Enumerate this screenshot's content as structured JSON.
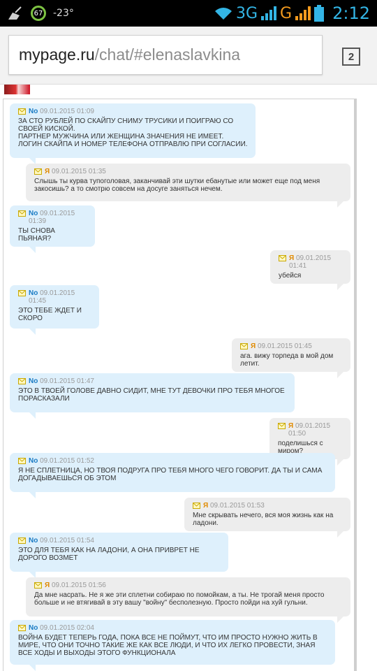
{
  "status_bar": {
    "battery_percent": "67",
    "temperature": "-23°",
    "network_3g": "3G",
    "network_g": "G",
    "time": "2:12"
  },
  "browser": {
    "url_host": "mypage.ru",
    "url_path": "/chat/#elenaslavkina",
    "tab_count": "2"
  },
  "chat": {
    "messages": [
      {
        "sender": "No",
        "time": "09.01.2015 01:09",
        "text": "ЗА СТО РУБЛЕЙ ПО СКАЙПУ СНИМУ ТРУСИКИ И ПОИГРАЮ СО СВОЕЙ КИСКОЙ.\nПАРТНЕР МУЖЧИНА ИЛИ ЖЕНЩИНА ЗНАЧЕНИЯ НЕ ИМЕЕТ.\nЛОГИН СКАЙПА И НОМЕР ТЕЛЕФОНА ОТПРАВЛЮ ПРИ СОГЛАСИИ."
      },
      {
        "sender": "Я",
        "time": "09.01.2015 01:35",
        "text": "Слышь ты курва тупоголовая, заканчивай эти шутки ебанутые или может еще под меня закосишь? а то смотрю совсем на досуге заняться нечем."
      },
      {
        "sender": "No",
        "time": "09.01.2015 01:39",
        "text": "ТЫ СНОВА ПЬЯНАЯ?"
      },
      {
        "sender": "Я",
        "time": "09.01.2015 01:41",
        "text": "убейся"
      },
      {
        "sender": "No",
        "time": "09.01.2015 01:45",
        "text": "ЭТО ТЕБЕ ЖДЕТ И СКОРО"
      },
      {
        "sender": "Я",
        "time": "09.01.2015 01:45",
        "text": "ага. вижу торпеда в мой дом летит."
      },
      {
        "sender": "No",
        "time": "09.01.2015 01:47",
        "text": "ЭТО В ТВОЕЙ ГОЛОВЕ ДАВНО СИДИТ, МНЕ ТУТ ДЕВОЧКИ ПРО ТЕБЯ МНОГОЕ ПОРАСКАЗАЛИ"
      },
      {
        "sender": "Я",
        "time": "09.01.2015 01:50",
        "text": "поделишься с миром?"
      },
      {
        "sender": "No",
        "time": "09.01.2015 01:52",
        "text": "Я НЕ СПЛЕТНИЦА, НО ТВОЯ ПОДРУГА ПРО ТЕБЯ МНОГО ЧЕГО ГОВОРИТ. ДА ТЫ И САМА ДОГАДЫВАЕШЬСЯ ОБ ЭТОМ"
      },
      {
        "sender": "Я",
        "time": "09.01.2015 01:53",
        "text": "Мне скрывать нечего, вся моя жизнь как на ладони."
      },
      {
        "sender": "No",
        "time": "09.01.2015 01:54",
        "text": "ЭТО ДЛЯ ТЕБЯ КАК НА ЛАДОНИ, А ОНА ПРИВРЕТ НЕ ДОРОГО ВОЗМЕТ"
      },
      {
        "sender": "Я",
        "time": "09.01.2015 01:56",
        "text": "Да мне насрать. Не я же эти сплетни собираю по помойкам, а ты. Не трогай меня просто больше и не втягивай в эту вашу \"войну\" бесполезную. Просто пойди на хуй гульни."
      },
      {
        "sender": "No",
        "time": "09.01.2015 02:04",
        "text": "ВОЙНА БУДЕТ ТЕПЕРЬ ГОДА, ПОКА ВСЕ НЕ ПОЙМУТ, ЧТО ИМ ПРОСТО НУЖНО ЖИТЬ В МИРЕ, ЧТО ОНИ ТОЧНО ТАКИЕ ЖЕ КАК ВСЕ ЛЮДИ, И ЧТО ИХ ЛЕГКО ПРОВЕСТИ, ЗНАЯ ВСЕ ХОДЫ И ВЫХОДЫ ЭТОГО ФУНКЦИОНАЛА"
      }
    ]
  }
}
